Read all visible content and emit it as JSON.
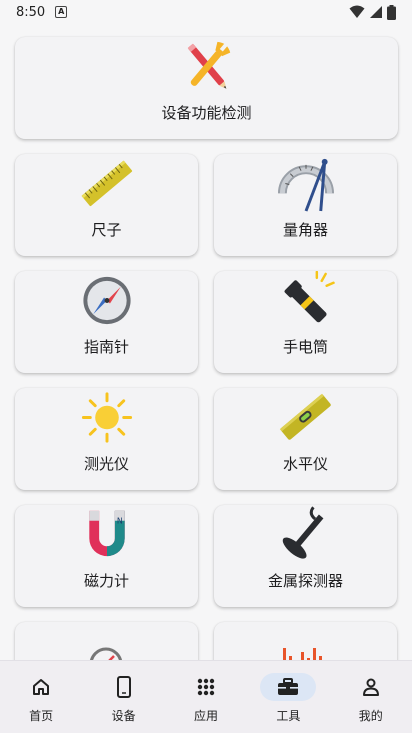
{
  "status_bar": {
    "time": "8:50",
    "notification_icon": "a-notification-icon"
  },
  "tools": [
    {
      "id": "device-check",
      "label": "设备功能检测",
      "icon": "wrench-pencil-icon"
    },
    {
      "id": "ruler",
      "label": "尺子",
      "icon": "ruler-icon"
    },
    {
      "id": "protractor",
      "label": "量角器",
      "icon": "protractor-icon"
    },
    {
      "id": "compass",
      "label": "指南针",
      "icon": "compass-icon"
    },
    {
      "id": "flashlight",
      "label": "手电筒",
      "icon": "flashlight-icon"
    },
    {
      "id": "light-meter",
      "label": "测光仪",
      "icon": "sun-icon"
    },
    {
      "id": "level",
      "label": "水平仪",
      "icon": "spirit-level-icon"
    },
    {
      "id": "magnetometer",
      "label": "磁力计",
      "icon": "magnet-icon"
    },
    {
      "id": "metal-detector",
      "label": "金属探测器",
      "icon": "metal-detector-icon"
    },
    {
      "id": "speed",
      "icon": "gauge-icon"
    },
    {
      "id": "sound",
      "icon": "sound-bars-icon"
    }
  ],
  "bottom_nav": {
    "active": "tools",
    "items": [
      {
        "id": "home",
        "label": "首页",
        "icon": "home-icon"
      },
      {
        "id": "device",
        "label": "设备",
        "icon": "phone-icon"
      },
      {
        "id": "apps",
        "label": "应用",
        "icon": "grid-icon"
      },
      {
        "id": "tools",
        "label": "工具",
        "icon": "toolbox-icon"
      },
      {
        "id": "mine",
        "label": "我的",
        "icon": "person-icon"
      }
    ]
  },
  "colors": {
    "accent_bg": "#dce6f5",
    "card_bg": "#f3f3f5",
    "page_bg": "#f6f6f7"
  }
}
